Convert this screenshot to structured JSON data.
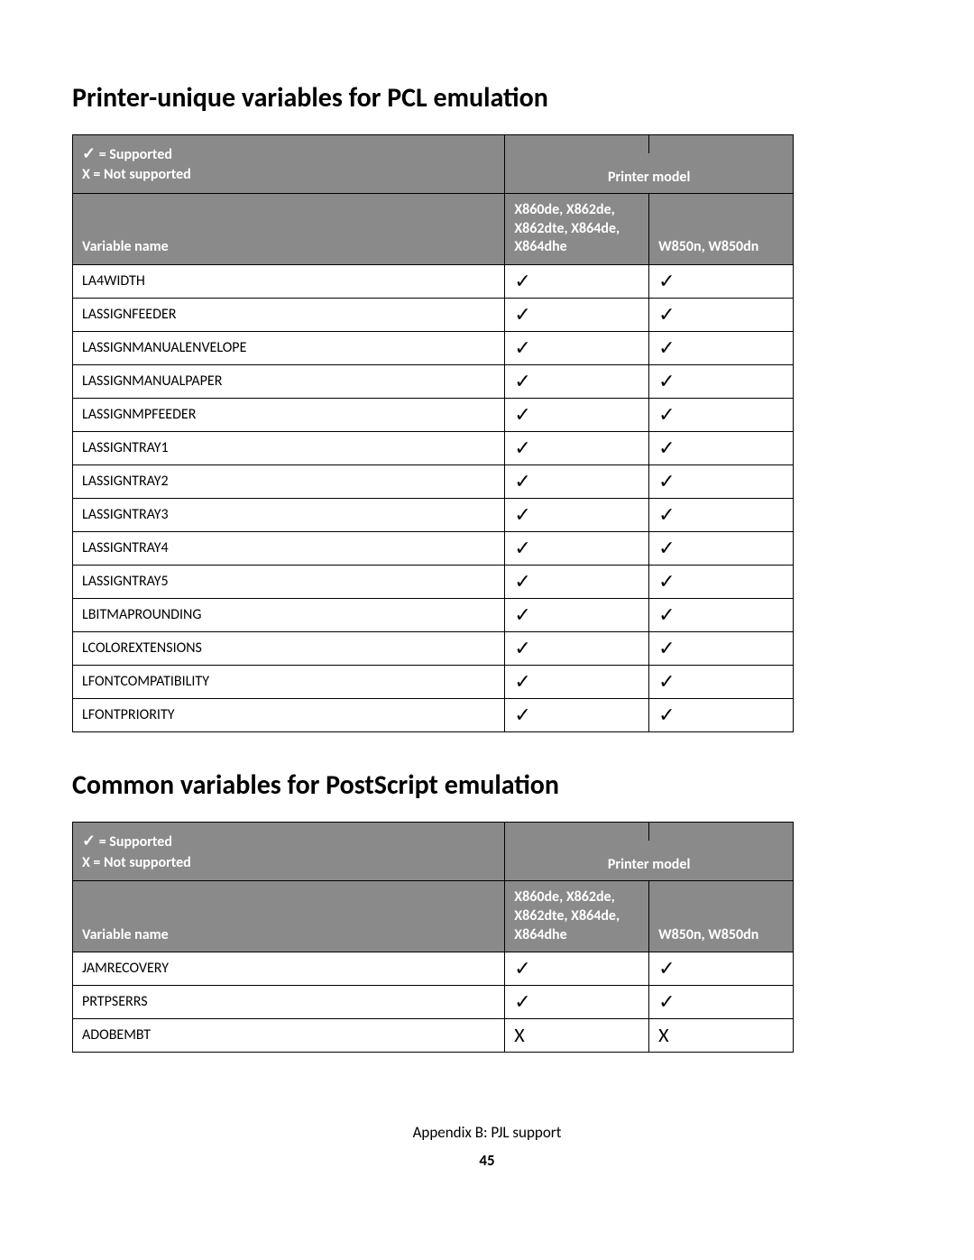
{
  "section1": {
    "title": "Printer-unique variables for PCL emulation",
    "legend": {
      "supported": "= Supported",
      "notsupported": "X = Not supported"
    },
    "header": {
      "printer_model": "Printer model",
      "variable_name": "Variable name",
      "col1": "X860de, X862de, X862dte, X864de, X864dhe",
      "col2": "W850n, W850dn"
    },
    "rows": [
      {
        "name": "LA4WIDTH",
        "c1": "✓",
        "c2": "✓"
      },
      {
        "name": "LASSIGNFEEDER",
        "c1": "✓",
        "c2": "✓"
      },
      {
        "name": "LASSIGNMANUALENVELOPE",
        "c1": "✓",
        "c2": "✓"
      },
      {
        "name": "LASSIGNMANUALPAPER",
        "c1": "✓",
        "c2": "✓"
      },
      {
        "name": "LASSIGNMPFEEDER",
        "c1": "✓",
        "c2": "✓"
      },
      {
        "name": "LASSIGNTRAY1",
        "c1": "✓",
        "c2": "✓"
      },
      {
        "name": "LASSIGNTRAY2",
        "c1": "✓",
        "c2": "✓"
      },
      {
        "name": "LASSIGNTRAY3",
        "c1": "✓",
        "c2": "✓"
      },
      {
        "name": "LASSIGNTRAY4",
        "c1": "✓",
        "c2": "✓"
      },
      {
        "name": "LASSIGNTRAY5",
        "c1": "✓",
        "c2": "✓"
      },
      {
        "name": "LBITMAPROUNDING",
        "c1": "✓",
        "c2": "✓"
      },
      {
        "name": "LCOLOREXTENSIONS",
        "c1": "✓",
        "c2": "✓"
      },
      {
        "name": "LFONTCOMPATIBILITY",
        "c1": "✓",
        "c2": "✓"
      },
      {
        "name": "LFONTPRIORITY",
        "c1": "✓",
        "c2": "✓"
      }
    ]
  },
  "section2": {
    "title": "Common variables for PostScript emulation",
    "legend": {
      "supported": "= Supported",
      "notsupported": "X = Not supported"
    },
    "header": {
      "printer_model": "Printer model",
      "variable_name": "Variable name",
      "col1": "X860de, X862de, X862dte, X864de, X864dhe",
      "col2": "W850n, W850dn"
    },
    "rows": [
      {
        "name": "JAMRECOVERY",
        "c1": "✓",
        "c2": "✓"
      },
      {
        "name": "PRTPSERRS",
        "c1": "✓",
        "c2": "✓"
      },
      {
        "name": "ADOBEMBT",
        "c1": "X",
        "c2": "X"
      }
    ]
  },
  "footer": {
    "text": "Appendix B: PJL support",
    "page": "45"
  },
  "check_glyph": "✓"
}
